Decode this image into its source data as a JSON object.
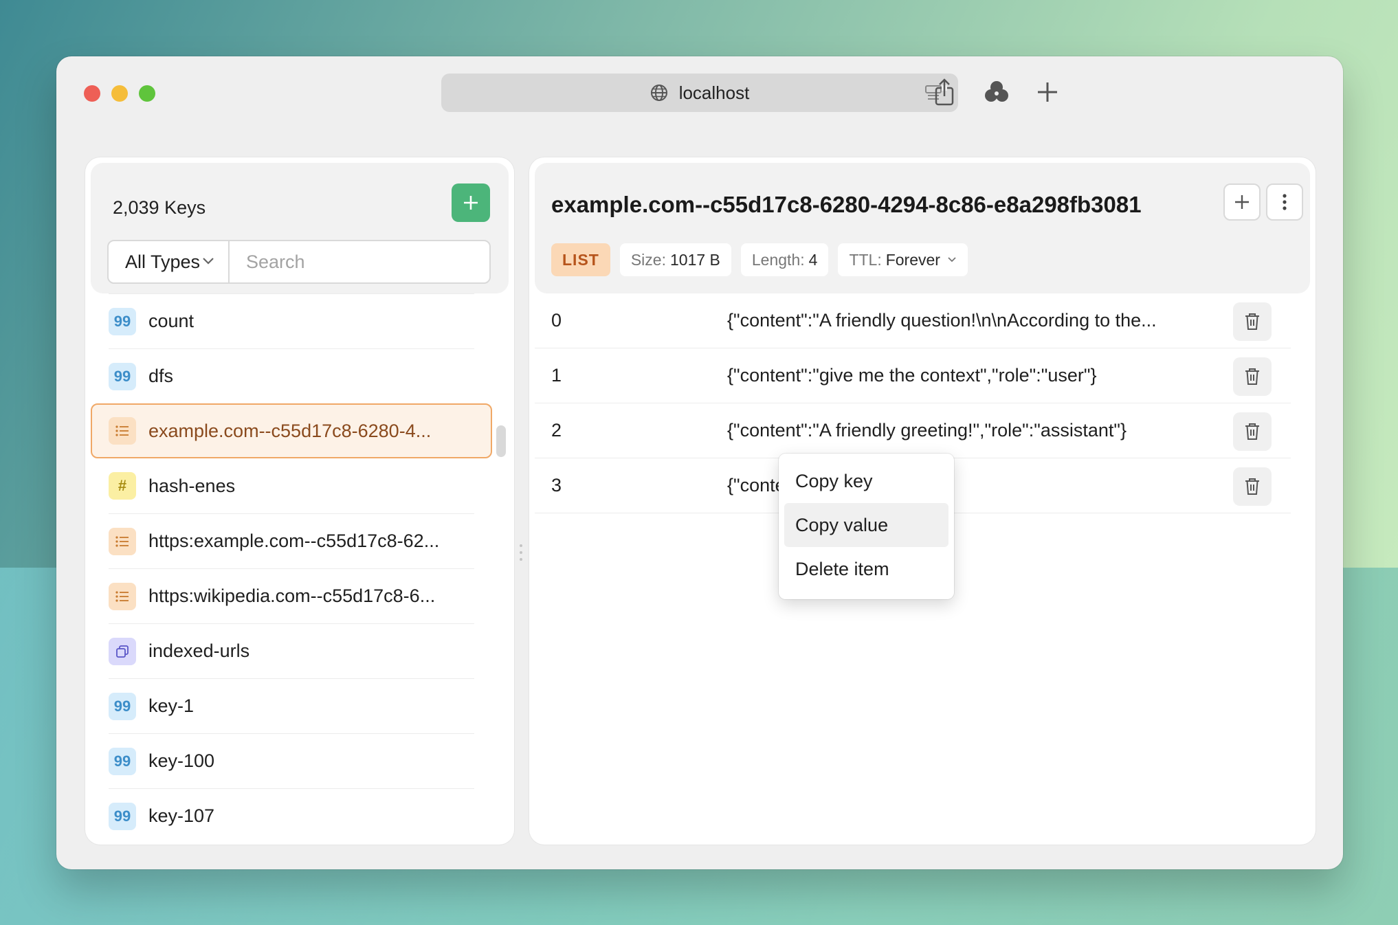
{
  "browser": {
    "url": "localhost"
  },
  "sidebar": {
    "keys_count": "2,039 Keys",
    "type_filter": "All Types",
    "search_placeholder": "Search",
    "items": [
      {
        "label": "count",
        "type": "string",
        "icon": "quote-icon"
      },
      {
        "label": "dfs",
        "type": "string",
        "icon": "quote-icon"
      },
      {
        "label": "example.com--c55d17c8-6280-4...",
        "type": "list",
        "icon": "list-icon",
        "selected": true
      },
      {
        "label": "hash-enes",
        "type": "hash",
        "icon": "hash-icon"
      },
      {
        "label": "https:example.com--c55d17c8-62...",
        "type": "list",
        "icon": "list-icon"
      },
      {
        "label": "https:wikipedia.com--c55d17c8-6...",
        "type": "list",
        "icon": "list-icon"
      },
      {
        "label": "indexed-urls",
        "type": "set",
        "icon": "set-icon"
      },
      {
        "label": "key-1",
        "type": "string",
        "icon": "quote-icon"
      },
      {
        "label": "key-100",
        "type": "string",
        "icon": "quote-icon"
      },
      {
        "label": "key-107",
        "type": "string",
        "icon": "quote-icon"
      }
    ]
  },
  "detail": {
    "key_title": "example.com--c55d17c8-6280-4294-8c86-e8a298fb3081",
    "type_tag": "LIST",
    "size_label": "Size:",
    "size_value": "1017 B",
    "length_label": "Length:",
    "length_value": "4",
    "ttl_label": "TTL:",
    "ttl_value": "Forever",
    "items": [
      {
        "index": "0",
        "value": "{\"content\":\"A friendly question!\\n\\nAccording to the..."
      },
      {
        "index": "1",
        "value": "{\"content\":\"give me the context\",\"role\":\"user\"}"
      },
      {
        "index": "2",
        "value": "{\"content\":\"A friendly greeting!\",\"role\":\"assistant\"}"
      },
      {
        "index": "3",
        "value": "{\"content\":\"user\"}"
      }
    ]
  },
  "context_menu": {
    "items": [
      "Copy key",
      "Copy value",
      "Delete item"
    ]
  },
  "colors": {
    "accent_green": "#4cb57a",
    "list_tag_bg": "#fbd8b6",
    "selected_border": "#f0a866"
  }
}
